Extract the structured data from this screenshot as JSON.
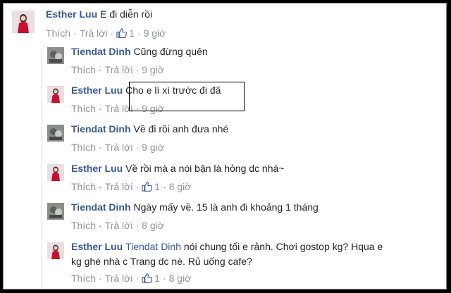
{
  "comments": [
    {
      "author": "Esther Luu",
      "text": "E đi diễn rồi",
      "like": "Thích",
      "reply": "Trả lời",
      "likes": "1",
      "time": "9 giờ"
    },
    {
      "author": "Tiendat Dinh",
      "text": "Cũng đừng quên",
      "like": "Thích",
      "reply": "Trả lời",
      "time": "9 giờ"
    },
    {
      "author": "Esther Luu",
      "text": "Cho e lì xì trước đi đã",
      "like": "Thích",
      "reply": "Trả lời",
      "time": "9 giờ"
    },
    {
      "author": "Tiendat Dinh",
      "text": "Về đi rồi anh đưa nhé",
      "like": "Thích",
      "reply": "Trả lời",
      "time": "9 giờ"
    },
    {
      "author": "Esther Luu",
      "text": "Về rồi mà a nói bận là hỏng dc nhá~",
      "like": "Thích",
      "reply": "Trả lời",
      "likes": "1",
      "time": "8 giờ"
    },
    {
      "author": "Tiendat Dinh",
      "text": "Ngày mấy về. 15 là anh đi khoảng 1 tháng",
      "like": "Thích",
      "reply": "Trả lời",
      "time": "8 giờ"
    },
    {
      "author": "Esther Luu",
      "mention": "Tiendat Dinh",
      "text1": "nói chung tối e rảnh. Chơi gostop kg? Hqua e",
      "text2": "kg ghé nhà c Trang dc nè. Rủ uống cafe?",
      "like": "Thích",
      "reply": "Trả lời",
      "likes": "1",
      "time": "8 giờ"
    }
  ],
  "colors": {
    "link": "#365899",
    "meta": "#90949c",
    "highlight_border": "#000000"
  }
}
